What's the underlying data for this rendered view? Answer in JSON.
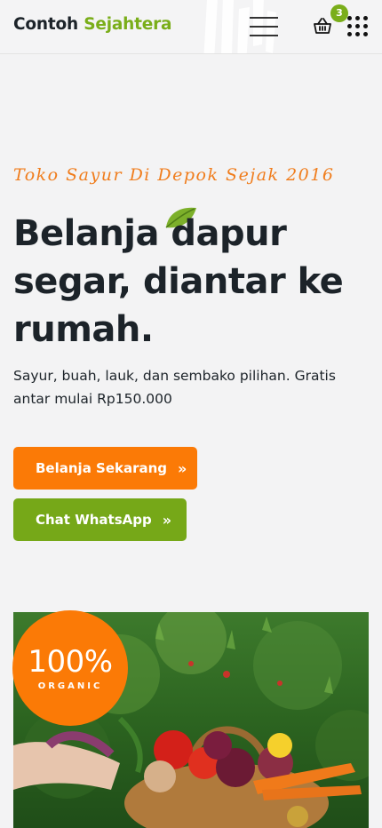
{
  "header": {
    "logo_word1": "Contoh",
    "logo_word2": "Sejahtera",
    "cart_count": "3"
  },
  "hero": {
    "tagline": "Toko Sayur Di Depok Sejak 2016",
    "headline": "Belanja dapur segar, diantar ke rumah.",
    "subtext": "Sayur, buah, lauk, dan sembako pilihan. Gratis antar mulai Rp150.000",
    "shop_button": "Belanja Sekarang",
    "whatsapp_button": "Chat WhatsApp",
    "button_chevron": "»"
  },
  "badge": {
    "percent": "100%",
    "label": "ORGANIC"
  },
  "colors": {
    "brand_green": "#7aae1a",
    "brand_orange": "#fb7a06",
    "text_dark": "#1c2329"
  },
  "icons": {
    "menu": "hamburger-icon",
    "cart": "basket-icon",
    "apps": "grid-dots-icon",
    "leaf": "leaf-icon"
  }
}
